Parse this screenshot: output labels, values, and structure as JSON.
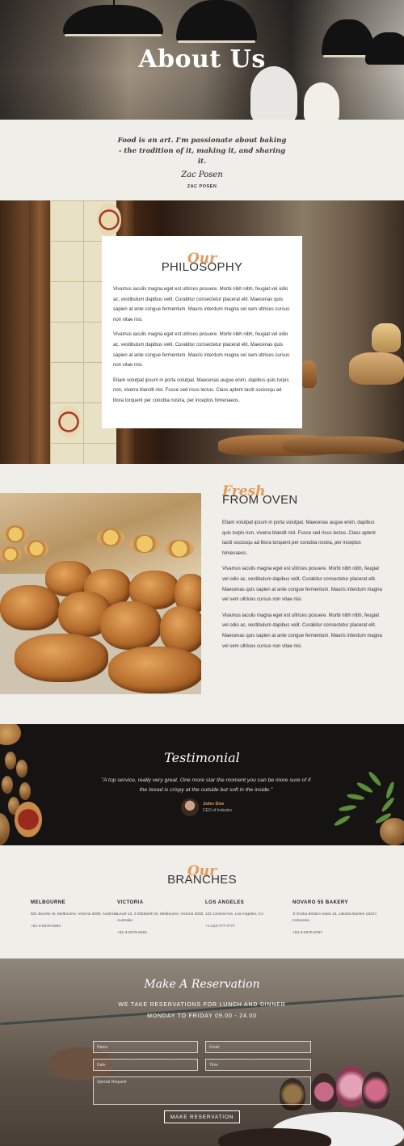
{
  "hero": {
    "title": "About Us"
  },
  "quote": {
    "text": "Food is an art. I'm passionate about baking - the tradition of it, making it, and sharing it.",
    "signature": "Zac Posen",
    "author": "ZAC POSEN"
  },
  "philosophy": {
    "script": "Our",
    "caps": "PHILOSOPHY",
    "paragraphs": [
      "Vivamus iaculis magna eget est ultrices posuere. Morbi nibh nibh, feugiat vel odio ac, vestibulum dapibus velit. Curabitur consectetur placerat elit. Maecenas quis sapien at ante congue fermentum. Mauris interdum magna vel sem ultrices cursus non vitae nisi.",
      "Vivamus iaculis magna eget est ultrices posuere. Morbi nibh nibh, feugiat vel odio ac, vestibulum dapibus velit. Curabitur consectetur placerat elit. Maecenas quis sapien at ante congue fermentum. Mauris interdum magna vel sem ultrices cursus non vitae nisi.",
      "Etiam volutpat ipsum in porta volutpat. Maecenas augue enim, dapibus quis turpis non, viverra blandit nisl. Fusce sed risus lectus. Class aptent taciti sociosqu ad litora torquent per conubia nostra, per inceptos himenaeos."
    ]
  },
  "oven": {
    "script": "Fresh",
    "caps": "FROM OVEN",
    "paragraphs": [
      "Etiam volutpat ipsum in porta volutpat. Maecenas augue enim, dapibus quis turpis non, viverra blandit nisl. Fusce sed risus lectus. Class aptent taciti sociosqu ad litora torquent per conubia nostra, per inceptos himenaeos.",
      "Vivamus iaculis magna eget est ultrices posuere. Morbi nibh nibh, feugiat vel odio ac, vestibulum dapibus velit. Curabitur consectetur placerat elit. Maecenas quis sapien at ante congue fermentum. Mauris interdum magna vel sem ultrices cursus non vitae nisi.",
      "Vivamus iaculis magna eget est ultrices posuere. Morbi nibh nibh, feugiat vel odio ac, vestibulum dapibus velit. Curabitur consectetur placerat elit. Maecenas quis sapien at ante congue fermentum. Mauris interdum magna vel sem ultrices cursus non vitae nisi."
    ]
  },
  "testimonial": {
    "title": "Testimonial",
    "quote": "\"A top service, really very great. One more star the moment you can be more sure of if the bread is crispy at the outside but soft in the inside.\"",
    "name": "John Doe",
    "role": "CEO of Industro"
  },
  "branches": {
    "script": "Our",
    "caps": "BRANCHES",
    "items": [
      {
        "name": "MELBOURNE",
        "address": "601 Bourke St, Melbourne, Victoria 3000, Australia",
        "phone": "+61-3-8376-6284"
      },
      {
        "name": "VICTORIA",
        "address": "Level 13, 2 Elizabeth St, Melbourne, Victoria 3000, Australia",
        "phone": "+61-3-8376-6284"
      },
      {
        "name": "LOS ANGELES",
        "address": "121 Central Ave, Los Angeles, CA",
        "phone": "+1-213-777-7777"
      },
      {
        "name": "NOVARO 55 BAKERY",
        "address": "Jl Graha Bintaro Utara 16, Jakarta Banten 15227, Indonesia",
        "phone": "+62-3-8376-6767"
      }
    ]
  },
  "reservation": {
    "title": "Make A Reservation",
    "line1": "WE TAKE RESERVATIONS FOR LUNCH AND DINNER",
    "line2": "MONDAY TO FRIDAY 09.00 - 24.00",
    "name_placeholder": "Name",
    "email_placeholder": "Email",
    "date_placeholder": "Date",
    "time_placeholder": "Time",
    "request_placeholder": "Special Request",
    "button": "MAKE RESERVATION"
  },
  "colors": {
    "accent": "#e39a5c",
    "background": "#efeee9",
    "dark": "#161412"
  }
}
